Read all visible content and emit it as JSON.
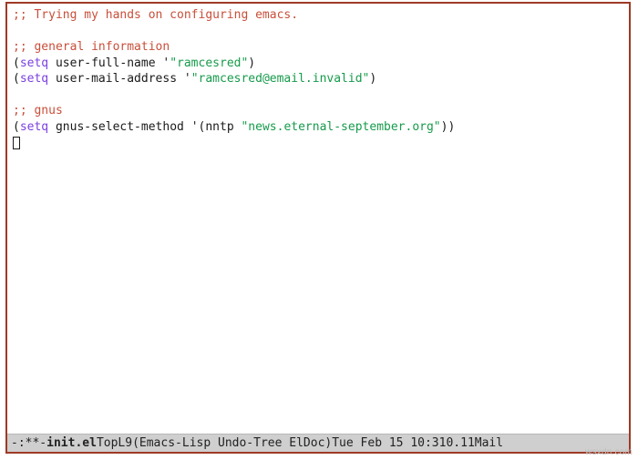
{
  "editor": {
    "comments": {
      "top": ";; Trying my hands on configuring emacs.",
      "general": ";; general information",
      "gnus": ";; gnus"
    },
    "forms": {
      "user_full_name": {
        "fn": "setq",
        "var": "user-full-name",
        "val": "\"ramcesred\""
      },
      "user_mail_address": {
        "fn": "setq",
        "var": "user-mail-address",
        "val": "\"ramcesred@email.invalid\""
      },
      "gnus_select_method": {
        "fn": "setq",
        "var": "gnus-select-method",
        "inner_fn": "nntp",
        "inner_val": "\"news.eternal-september.org\""
      }
    }
  },
  "modeline": {
    "status": "-:**-",
    "buffer": "init.el",
    "position": "Top",
    "line": "L9",
    "modes": "(Emacs-Lisp Undo-Tree ElDoc)",
    "datetime": "Tue Feb 15 10:31",
    "load": "0.11",
    "mail": "Mail"
  },
  "watermark": "wsxdn.com"
}
